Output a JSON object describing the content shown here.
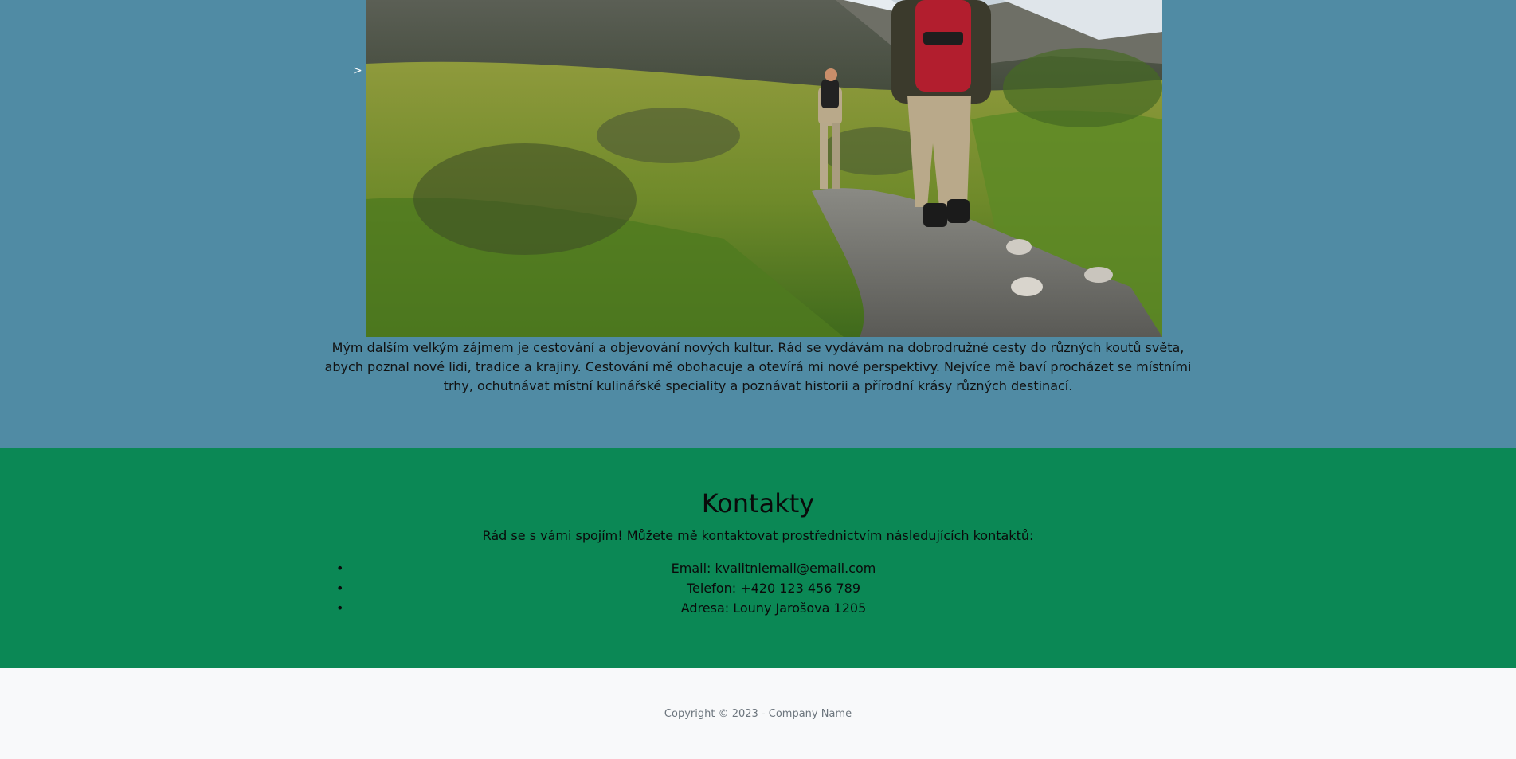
{
  "travel": {
    "arrow": ">",
    "text": "Mým dalším velkým zájmem je cestování a objevování nových kultur. Rád se vydávám na dobrodružné cesty do různých koutů světa, abych poznal nové lidi, tradice a krajiny. Cestování mě obohacuje a otevírá mi nové perspektivy. Nejvíce mě baví procházet se místními trhy, ochutnávat místní kulinářské speciality a poznávat historii a přírodní krásy různých destinací."
  },
  "contacts": {
    "title": "Kontakty",
    "intro": "Rád se s vámi spojím! Můžete mě kontaktovat prostřednictvím následujících kontaktů:",
    "items": [
      "Email: kvalitniemail@email.com",
      "Telefon: +420 123 456 789",
      "Adresa: Louny Jarošova 1205"
    ]
  },
  "footer": {
    "copyright": "Copyright © 2023 - Company Name"
  },
  "colors": {
    "travel_bg": "#508ba4",
    "contacts_bg": "#0b8855",
    "footer_bg": "#f8f9fa"
  }
}
